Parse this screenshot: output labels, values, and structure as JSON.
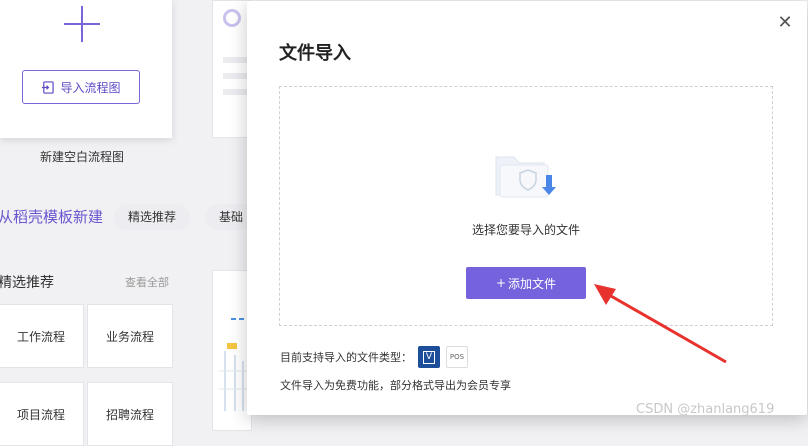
{
  "background": {
    "import_button_label": "导入流程图",
    "new_blank_caption": "新建空白流程图",
    "template_section_title": "从稻壳模板新建",
    "chips": [
      "精选推荐",
      "基础"
    ],
    "featured_title": "精选推荐",
    "see_all": "查看全部",
    "categories": [
      "工作流程",
      "业务流程",
      "项目流程",
      "招聘流程"
    ]
  },
  "modal": {
    "title": "文件导入",
    "close_glyph": "✕",
    "dropzone_text": "选择您要导入的文件",
    "add_button_label": "添加文件",
    "add_button_prefix": "+",
    "support_label": "目前支持导入的文件类型：",
    "formats": [
      {
        "icon": "visio-file-icon",
        "label": "V"
      },
      {
        "icon": "pos-file-icon",
        "label": "POS"
      }
    ],
    "note": "文件导入为免费功能，部分格式导出为会员专享"
  },
  "annotation": {
    "color": "#e8322e"
  },
  "watermark": "CSDN @zhanlang619",
  "colors": {
    "accent": "#7463dc",
    "visio_blue": "#1d4e9a"
  }
}
